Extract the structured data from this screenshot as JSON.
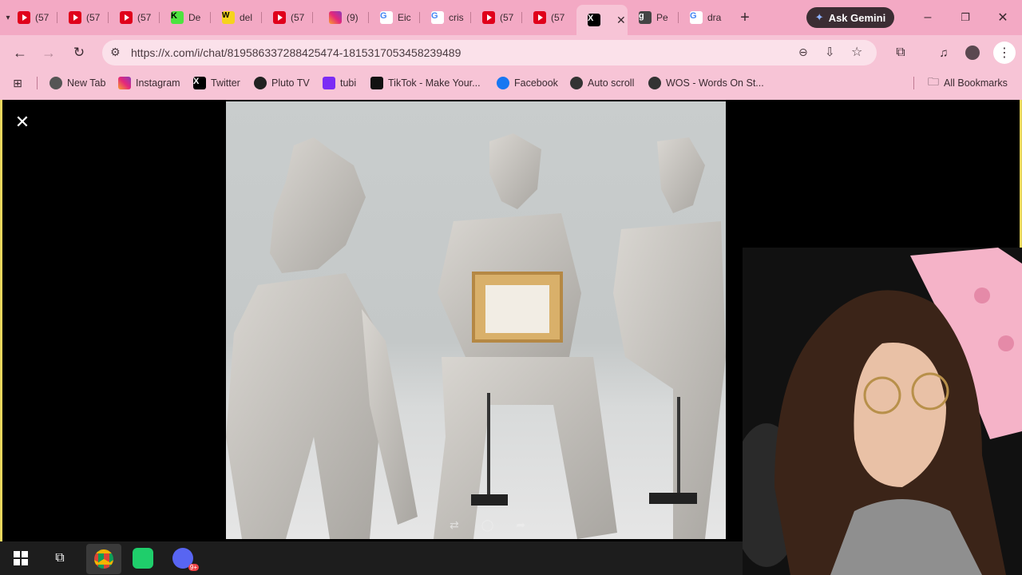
{
  "tabs": [
    {
      "label": "(57",
      "icon": "youtube-icon"
    },
    {
      "label": "(57",
      "icon": "youtube-icon"
    },
    {
      "label": "(57",
      "icon": "youtube-icon"
    },
    {
      "label": "De",
      "icon": "kick-icon"
    },
    {
      "label": "del",
      "icon": "webtoon-icon"
    },
    {
      "label": "(57",
      "icon": "youtube-icon"
    },
    {
      "label": "(9)",
      "icon": "instagram-icon"
    },
    {
      "label": "Eic",
      "icon": "google-icon"
    },
    {
      "label": "cris",
      "icon": "google-icon"
    },
    {
      "label": "(57",
      "icon": "youtube-icon"
    },
    {
      "label": "(57",
      "icon": "youtube-icon"
    },
    {
      "label": "",
      "icon": "x-icon",
      "active": true
    },
    {
      "label": "Pe",
      "icon": "genius-icon"
    },
    {
      "label": "dra",
      "icon": "google-icon"
    }
  ],
  "gemini": {
    "label": "Ask Gemini"
  },
  "address": {
    "url": "https://x.com/i/chat/819586337288425474-1815317053458239489"
  },
  "bookmarks": [
    {
      "label": "New Tab"
    },
    {
      "label": "Instagram"
    },
    {
      "label": "Twitter"
    },
    {
      "label": "Pluto TV"
    },
    {
      "label": "tubi"
    },
    {
      "label": "TikTok - Make Your..."
    },
    {
      "label": "Facebook"
    },
    {
      "label": "Auto scroll"
    },
    {
      "label": "WOS - Words On St..."
    }
  ],
  "all_bookmarks": "All Bookmarks",
  "taskbar": {
    "discord_badge": "9+"
  },
  "colors": {
    "chrome": "#f7c4d6",
    "tabstrip": "#f3a9c4",
    "viewer_border": "#e9d75e"
  }
}
